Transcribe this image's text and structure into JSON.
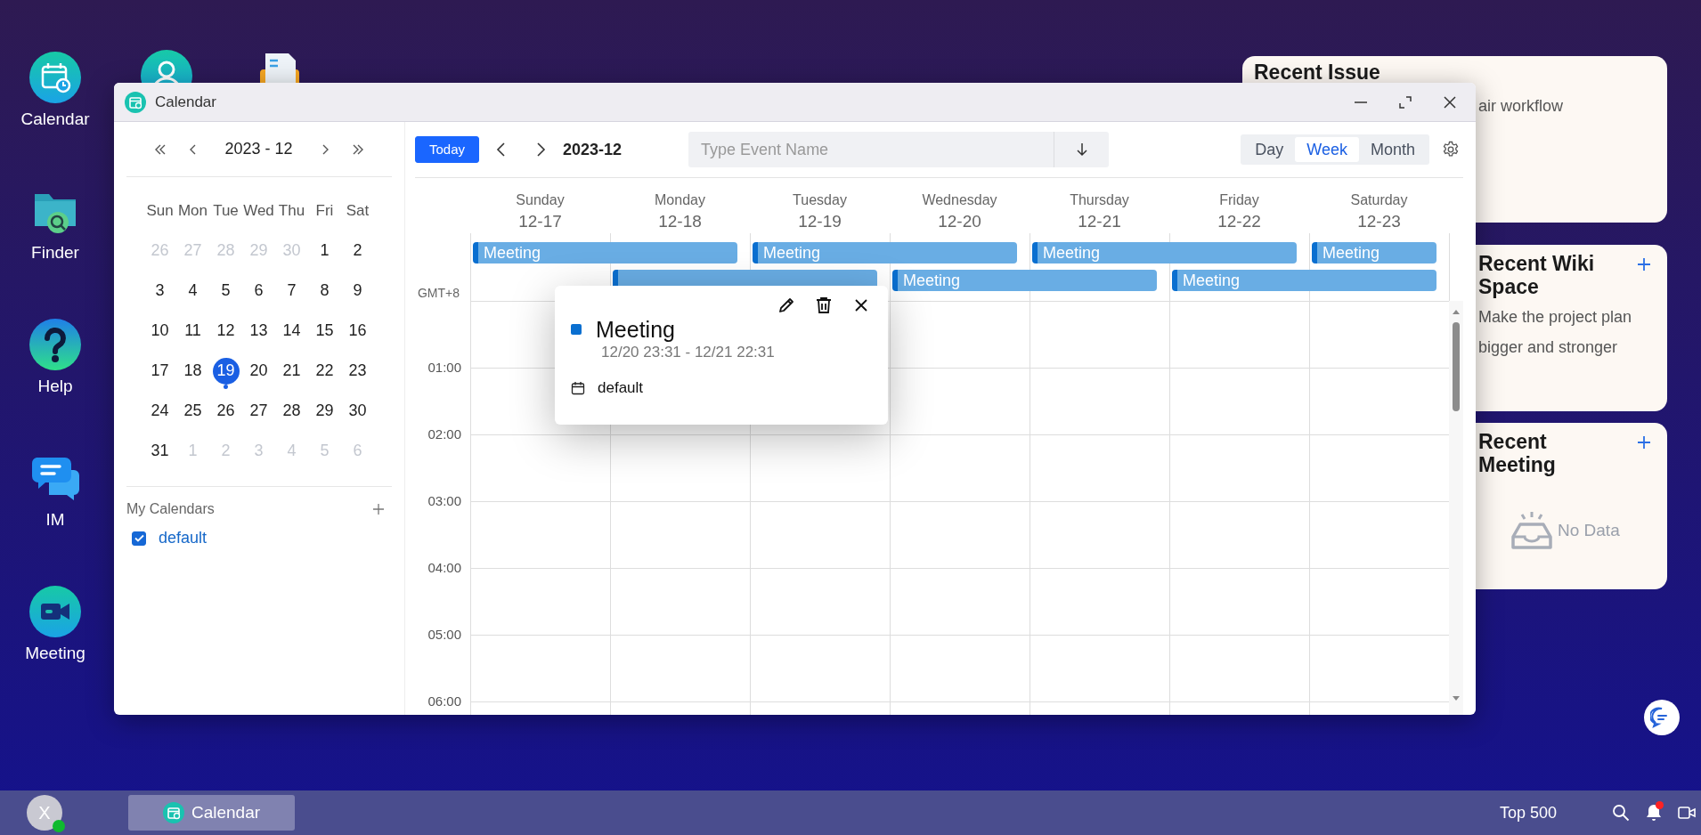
{
  "desktop_icons": [
    {
      "kind": "calendar",
      "label": "Calendar"
    },
    {
      "kind": "finder",
      "label": "Finder"
    },
    {
      "kind": "help",
      "label": "Help"
    },
    {
      "kind": "chat",
      "label": "IM"
    },
    {
      "kind": "video",
      "label": "Meeting"
    }
  ],
  "hidden_icons": [
    {
      "kind": "person"
    },
    {
      "kind": "files"
    }
  ],
  "window": {
    "title": "Calendar"
  },
  "mini_calendar": {
    "month": "2023 - 12",
    "weekdays": [
      "Sun",
      "Mon",
      "Tue",
      "Wed",
      "Thu",
      "Fri",
      "Sat"
    ],
    "weeks": [
      [
        {
          "label": "26",
          "muted": true,
          "selected": false,
          "has_event": false
        },
        {
          "label": "27",
          "muted": true,
          "selected": false,
          "has_event": false
        },
        {
          "label": "28",
          "muted": true,
          "selected": false,
          "has_event": false
        },
        {
          "label": "29",
          "muted": true,
          "selected": false,
          "has_event": false
        },
        {
          "label": "30",
          "muted": true,
          "selected": false,
          "has_event": false
        },
        {
          "label": "1",
          "muted": false,
          "selected": false,
          "has_event": false
        },
        {
          "label": "2",
          "muted": false,
          "selected": false,
          "has_event": false
        }
      ],
      [
        {
          "label": "3",
          "muted": false,
          "selected": false,
          "has_event": false
        },
        {
          "label": "4",
          "muted": false,
          "selected": false,
          "has_event": false
        },
        {
          "label": "5",
          "muted": false,
          "selected": false,
          "has_event": false
        },
        {
          "label": "6",
          "muted": false,
          "selected": false,
          "has_event": false
        },
        {
          "label": "7",
          "muted": false,
          "selected": false,
          "has_event": false
        },
        {
          "label": "8",
          "muted": false,
          "selected": false,
          "has_event": false
        },
        {
          "label": "9",
          "muted": false,
          "selected": false,
          "has_event": false
        }
      ],
      [
        {
          "label": "10",
          "muted": false,
          "selected": false,
          "has_event": false
        },
        {
          "label": "11",
          "muted": false,
          "selected": false,
          "has_event": false
        },
        {
          "label": "12",
          "muted": false,
          "selected": false,
          "has_event": false
        },
        {
          "label": "13",
          "muted": false,
          "selected": false,
          "has_event": false
        },
        {
          "label": "14",
          "muted": false,
          "selected": false,
          "has_event": false
        },
        {
          "label": "15",
          "muted": false,
          "selected": false,
          "has_event": false
        },
        {
          "label": "16",
          "muted": false,
          "selected": false,
          "has_event": false
        }
      ],
      [
        {
          "label": "17",
          "muted": false,
          "selected": false,
          "has_event": false
        },
        {
          "label": "18",
          "muted": false,
          "selected": false,
          "has_event": false
        },
        {
          "label": "19",
          "muted": false,
          "selected": true,
          "has_event": true
        },
        {
          "label": "20",
          "muted": false,
          "selected": false,
          "has_event": false
        },
        {
          "label": "21",
          "muted": false,
          "selected": false,
          "has_event": false
        },
        {
          "label": "22",
          "muted": false,
          "selected": false,
          "has_event": false
        },
        {
          "label": "23",
          "muted": false,
          "selected": false,
          "has_event": false
        }
      ],
      [
        {
          "label": "24",
          "muted": false,
          "selected": false,
          "has_event": false
        },
        {
          "label": "25",
          "muted": false,
          "selected": false,
          "has_event": false
        },
        {
          "label": "26",
          "muted": false,
          "selected": false,
          "has_event": false
        },
        {
          "label": "27",
          "muted": false,
          "selected": false,
          "has_event": false
        },
        {
          "label": "28",
          "muted": false,
          "selected": false,
          "has_event": false
        },
        {
          "label": "29",
          "muted": false,
          "selected": false,
          "has_event": false
        },
        {
          "label": "30",
          "muted": false,
          "selected": false,
          "has_event": false
        }
      ],
      [
        {
          "label": "31",
          "muted": false,
          "selected": false,
          "has_event": false
        },
        {
          "label": "1",
          "muted": true,
          "selected": false,
          "has_event": false
        },
        {
          "label": "2",
          "muted": true,
          "selected": false,
          "has_event": false
        },
        {
          "label": "3",
          "muted": true,
          "selected": false,
          "has_event": false
        },
        {
          "label": "4",
          "muted": true,
          "selected": false,
          "has_event": false
        },
        {
          "label": "5",
          "muted": true,
          "selected": false,
          "has_event": false
        },
        {
          "label": "6",
          "muted": true,
          "selected": false,
          "has_event": false
        }
      ]
    ]
  },
  "my_calendars": {
    "title": "My Calendars",
    "items": [
      {
        "label": "default",
        "checked": true
      }
    ]
  },
  "toolbar": {
    "today": "Today",
    "month": "2023-12",
    "search": {
      "placeholder": "Type Event Name"
    },
    "views": [
      {
        "label": "Day",
        "selected": false
      },
      {
        "label": "Week",
        "selected": true
      },
      {
        "label": "Month",
        "selected": false
      }
    ]
  },
  "week": {
    "days": [
      {
        "name": "Sunday",
        "date": "12-17"
      },
      {
        "name": "Monday",
        "date": "12-18"
      },
      {
        "name": "Tuesday",
        "date": "12-19"
      },
      {
        "name": "Wednesday",
        "date": "12-20"
      },
      {
        "name": "Thursday",
        "date": "12-21"
      },
      {
        "name": "Friday",
        "date": "12-22"
      },
      {
        "name": "Saturday",
        "date": "12-23"
      }
    ],
    "all_day_rows": [
      [
        {
          "kind": "start",
          "title": "Meeting"
        },
        {
          "kind": "continue"
        },
        {
          "kind": "start",
          "title": "Meeting"
        },
        {
          "kind": "continue"
        },
        {
          "kind": "start",
          "title": "Meeting"
        },
        {
          "kind": "continue"
        },
        {
          "kind": "start",
          "title": "Meeting"
        }
      ],
      [
        {
          "kind": "empty"
        },
        {
          "kind": "start"
        },
        {
          "kind": "continue"
        },
        {
          "kind": "start",
          "title": "Meeting"
        },
        {
          "kind": "continue"
        },
        {
          "kind": "start",
          "title": "Meeting"
        },
        {
          "kind": "continue"
        }
      ]
    ],
    "timezone": "GMT+8",
    "hours": [
      "01:00",
      "02:00",
      "03:00",
      "04:00",
      "05:00",
      "06:00"
    ]
  },
  "popup": {
    "title": "Meeting",
    "time": "12/20 23:31 - 12/21 22:31",
    "calendar": "default"
  },
  "widgets": [
    {
      "kind": "text",
      "title": "Recent Issue",
      "text": "air workflow",
      "add": false
    },
    {
      "kind": "text",
      "title": "Recent Wiki Space",
      "text": "Make the project plan bigger and stronger",
      "add": true
    },
    {
      "kind": "empty",
      "title": "Recent Meeting",
      "empty_text": "No Data",
      "add": true
    }
  ],
  "taskbar": {
    "avatar": "X",
    "online": true,
    "tasks": [
      {
        "label": "Calendar",
        "active": true
      }
    ],
    "tray_text": "Top 500",
    "unread": true
  }
}
